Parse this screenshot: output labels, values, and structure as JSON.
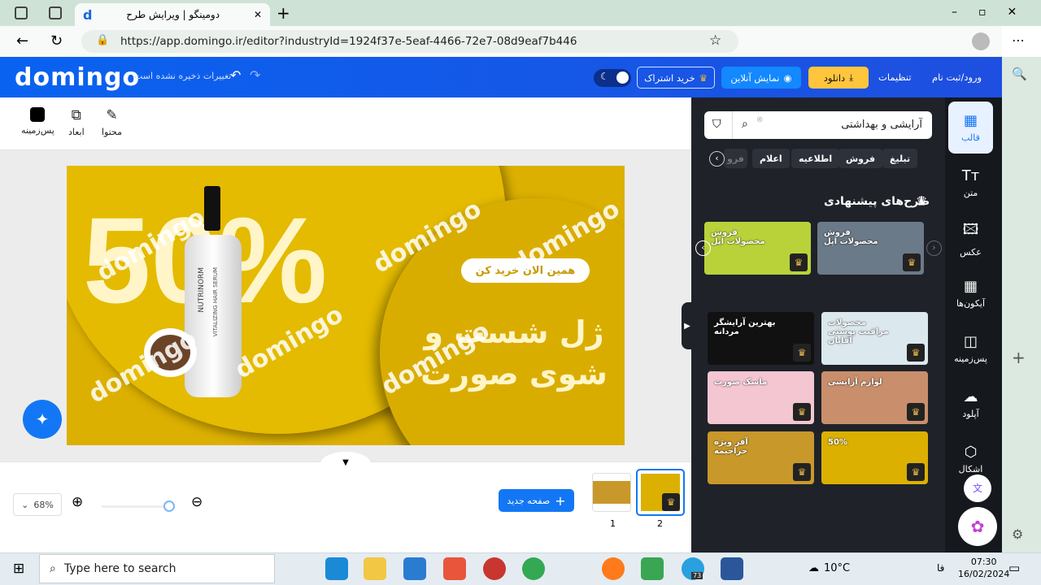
{
  "browser": {
    "tab_title": "دومینگو | ویرایش طرح",
    "url": "https://app.domingo.ir/editor?industryId=1924f37e-5eaf-4466-72e7-08d9eaf7b446"
  },
  "header": {
    "logo": "domingo",
    "save_status": "تغییرات ذخیره نشده است",
    "login": "ورود/ثبت نام",
    "settings": "تنظیمات",
    "download": "دانلود",
    "preview": "نمایش آنلاین",
    "subscribe": "خرید اشتراک",
    "accent": "#0a62f0"
  },
  "toolbar": {
    "content": "محتوا",
    "dimensions": "ابعاد",
    "background": "پس‌زمینه"
  },
  "design": {
    "big_text": "50%",
    "cta": "همین الان خرید کن",
    "line1": "ژل شست و",
    "line2": "شوی صورت",
    "bottle_brand": "NUTRINORM",
    "bottle_label": "VITALIZING HAIR SERUM",
    "watermark": "domingo"
  },
  "bottom": {
    "zoom": "68%",
    "new_page": "صفحه جدید",
    "pages": [
      "1",
      "2"
    ]
  },
  "panel": {
    "search_value": "آرایشی و بهداشتی",
    "chips": [
      "تبلیغ",
      "فروش",
      "اطلاعیه",
      "اعلام",
      "فرو"
    ],
    "section_title": "طرح‌های پیشنهادی",
    "templates": [
      {
        "text": "فروش محصولات اپل",
        "color": "#6b7a88"
      },
      {
        "text": "فروش محصولات اپل",
        "color": "#b9d23a"
      },
      {
        "text": "محصولات مراقبت پوستی آقایان",
        "color": "#dbe8ee"
      },
      {
        "text": "بهترین آرایشگر مردانه",
        "color": "#111"
      },
      {
        "text": "لوازم آرایشی",
        "color": "#c98f6c"
      },
      {
        "text": "ماسک صورت",
        "color": "#f3c6d2"
      },
      {
        "text": "50%",
        "color": "#dcb000"
      },
      {
        "text": "آفر ویژه حراجیمه",
        "color": "#c9982a"
      }
    ]
  },
  "nav": {
    "items": [
      "قالب",
      "متن",
      "عکس",
      "آیکون‌ها",
      "پس‌زمینه",
      "آپلود",
      "اشکال"
    ]
  },
  "taskbar": {
    "search": "Type here to search",
    "weather": "10°C",
    "lang": "فا",
    "time": "07:30",
    "date": "16/02/2024",
    "badge": "73"
  }
}
